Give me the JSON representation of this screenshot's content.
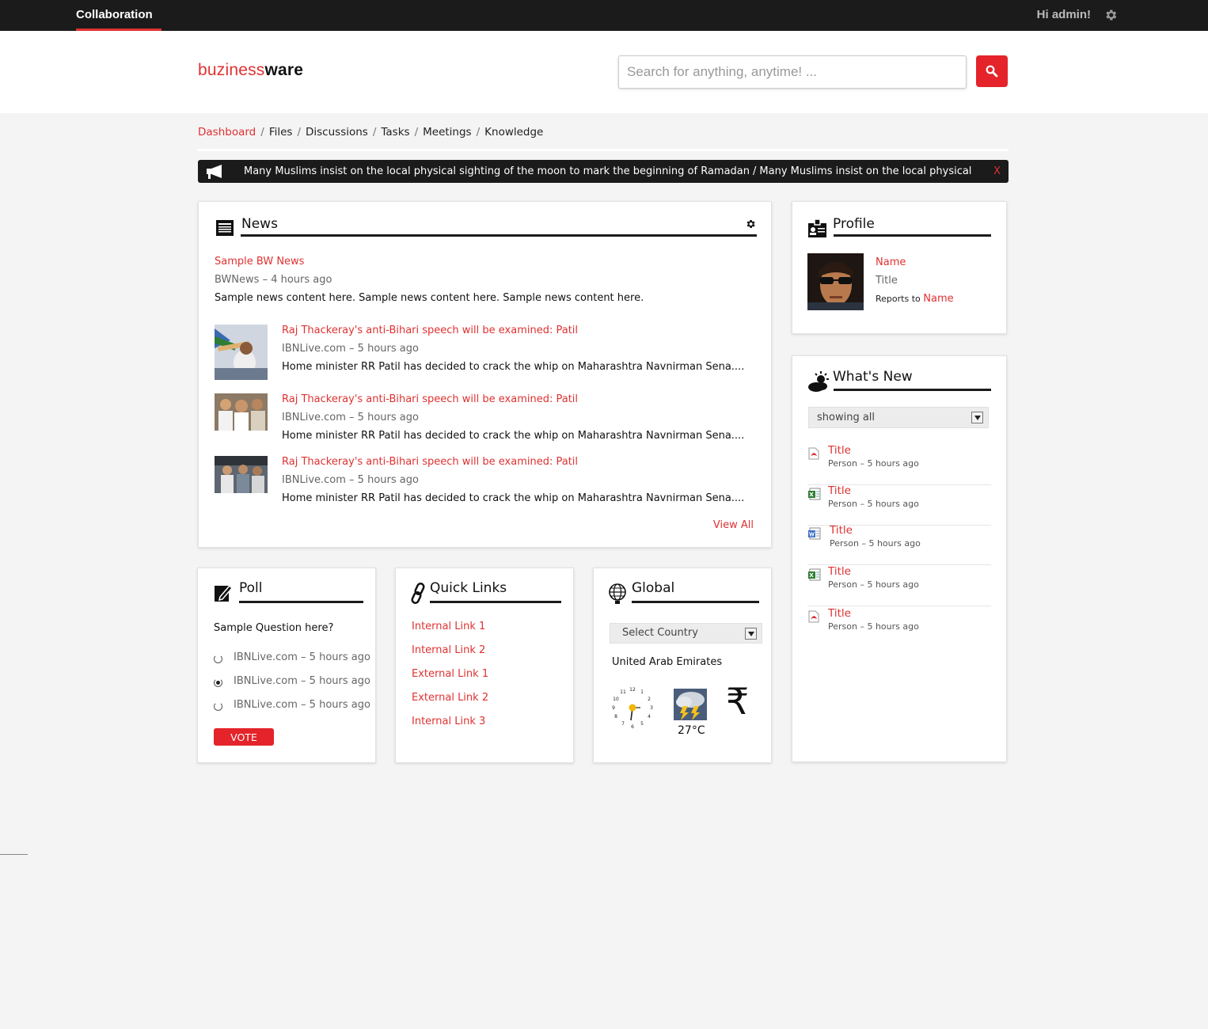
{
  "topbar": {
    "app_title": "Collaboration",
    "greeting": "Hi admin!",
    "settings_icon": "gear-icon"
  },
  "header": {
    "logo_part1": "buziness",
    "logo_part2": "ware",
    "search_placeholder": "Search for anything, anytime! ...",
    "search_icon": "search-icon"
  },
  "breadcrumb": [
    "Dashboard",
    "Files",
    "Discussions",
    "Tasks",
    "Meetings",
    "Knowledge"
  ],
  "ticker": {
    "icon": "megaphone-icon",
    "items": [
      "Many Muslims insist on the local physical sighting of the moon to mark the beginning of Ramadan",
      "Many Muslims insist on the local physical"
    ],
    "separator": "/",
    "close": "X"
  },
  "news": {
    "title": "News",
    "featured": {
      "title": "Sample BW News",
      "meta": "BWNews – 4 hours ago",
      "body": "Sample news content here. Sample news content here. Sample news content here."
    },
    "items": [
      {
        "title": "Raj Thackeray's anti-Bihari speech will be examined: Patil",
        "meta": "IBNLive.com – 5 hours ago",
        "body": "Home minister RR Patil has decided to crack the whip on Maharashtra Navnirman Sena...."
      },
      {
        "title": "Raj Thackeray's anti-Bihari speech will be examined: Patil",
        "meta": "IBNLive.com – 5 hours ago",
        "body": "Home minister RR Patil has decided to crack the whip on Maharashtra Navnirman Sena...."
      },
      {
        "title": "Raj Thackeray's anti-Bihari speech will be examined: Patil",
        "meta": "IBNLive.com – 5 hours ago",
        "body": "Home minister RR Patil has decided to crack the whip on Maharashtra Navnirman Sena...."
      }
    ],
    "view_all": "View All"
  },
  "profile": {
    "title": "Profile",
    "name": "Name",
    "job_title": "Title",
    "reports_to_label": "Reports to",
    "reports_to_name": "Name"
  },
  "whats_new": {
    "title": "What's New",
    "filter": "showing all",
    "items": [
      {
        "icon": "pdf-file-icon",
        "title": "Title",
        "meta": "Person – 5 hours ago"
      },
      {
        "icon": "excel-file-icon",
        "title": "Title",
        "meta": "Person – 5 hours ago"
      },
      {
        "icon": "word-file-icon",
        "title": "Title",
        "meta": "Person – 5 hours ago"
      },
      {
        "icon": "excel-file-icon",
        "title": "Title",
        "meta": "Person – 5 hours ago"
      },
      {
        "icon": "pdf-file-icon",
        "title": "Title",
        "meta": "Person – 5 hours ago"
      }
    ]
  },
  "poll": {
    "title": "Poll",
    "question": "Sample Question here?",
    "options": [
      "IBNLive.com – 5 hours ago",
      "IBNLive.com – 5 hours ago",
      "IBNLive.com – 5 hours ago"
    ],
    "selected_index": 1,
    "vote_label": "VOTE"
  },
  "quick_links": {
    "title": "Quick Links",
    "links": [
      "Internal Link 1",
      "Internal Link 2",
      "External Link 1",
      "External Link 2",
      "Internal Link 3"
    ]
  },
  "global": {
    "title": "Global",
    "country_select": "Select Country",
    "country": "United Arab Emirates",
    "temperature": "27°C",
    "currency_symbol": "₹"
  },
  "colors": {
    "accent": "#e4232a",
    "dark": "#1b1b1b",
    "background": "#f4f4f4"
  }
}
